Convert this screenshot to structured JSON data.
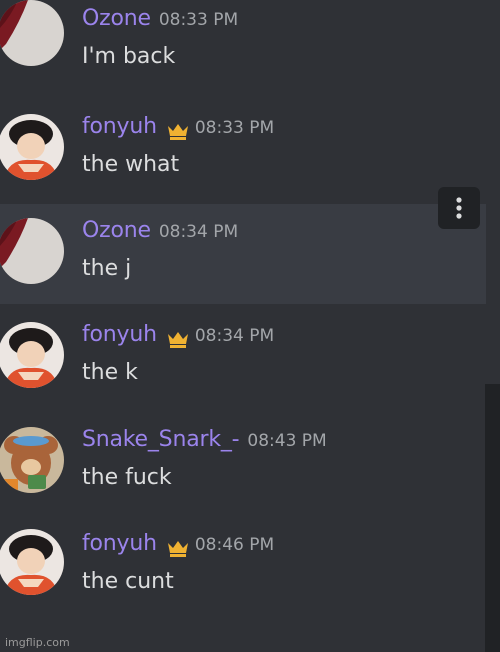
{
  "messages": [
    {
      "username": "Ozone",
      "time": "08:33 PM",
      "text": "I'm back",
      "crown": false
    },
    {
      "username": "fonyuh",
      "time": "08:33 PM",
      "text": "the what",
      "crown": true
    },
    {
      "username": "Ozone",
      "time": "08:34 PM",
      "text": "the j",
      "crown": false,
      "highlighted": true
    },
    {
      "username": "fonyuh",
      "time": "08:34 PM",
      "text": "the k",
      "crown": true
    },
    {
      "username": "Snake_Snark_-",
      "time": "08:43 PM",
      "text": "the fuck",
      "crown": false
    },
    {
      "username": "fonyuh",
      "time": "08:46 PM",
      "text": "the cunt",
      "crown": true
    }
  ],
  "icons": {
    "more": "vertical-dots-icon",
    "crown": "crown-icon"
  },
  "colors": {
    "background": "#2f3136",
    "highlight": "#393c43",
    "username": "#9b84ec",
    "crown": "#f0b232",
    "timestamp": "#a3a6aa",
    "message_text": "#dcddde"
  },
  "watermark": "imgflip.com"
}
